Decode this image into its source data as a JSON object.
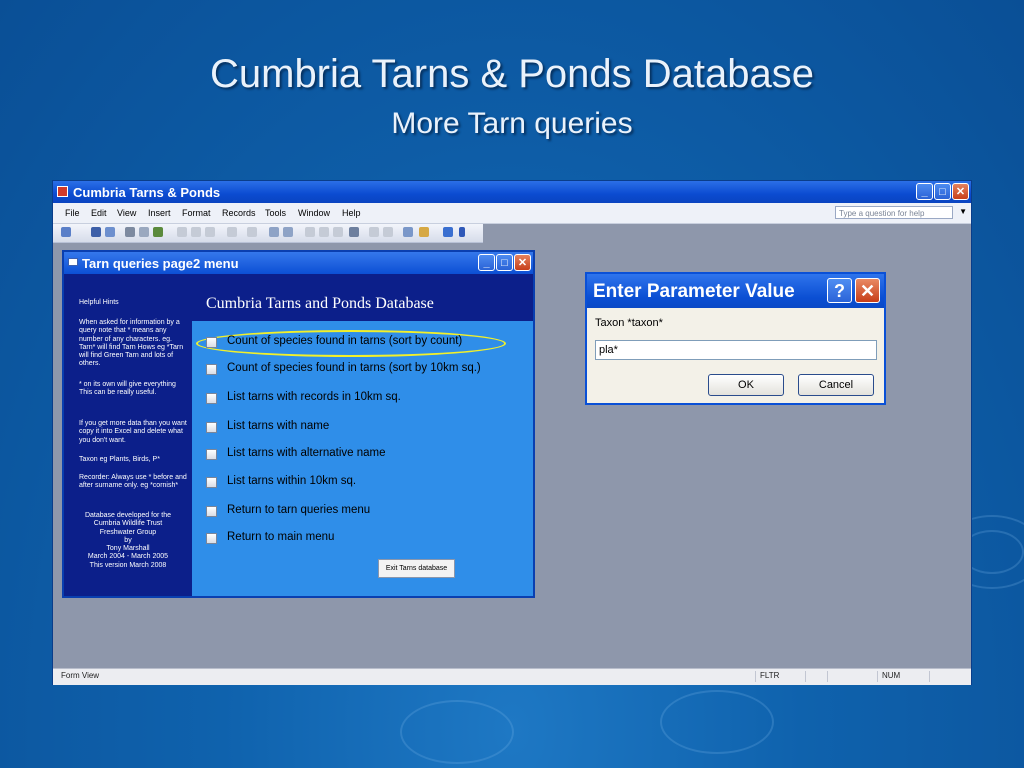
{
  "slide": {
    "title": "Cumbria Tarns & Ponds Database",
    "subtitle": "More Tarn queries"
  },
  "app_window": {
    "title": "Cumbria Tarns & Ponds",
    "menu": [
      "File",
      "Edit",
      "View",
      "Insert",
      "Format",
      "Records",
      "Tools",
      "Window",
      "Help"
    ],
    "help_placeholder": "Type a question for help"
  },
  "form": {
    "title": "Tarn queries page2 menu",
    "header": "Cumbria Tarns and Ponds Database",
    "hints_title": "Helpful Hints",
    "hints": [
      "When asked for information by a query note that * means any number of any characters. eg. Tarn* will find Tarn Hows eg *Tarn will find Green Tarn and lots of others.",
      "* on its own will give everything This can be really useful.",
      "If you get more data than you want copy it into Excel and delete what you don't want.",
      "Taxon eg Plants, Birds, P*",
      "Recorder: Always use * before and after surname only. eg *cornish*"
    ],
    "credits": [
      "Database developed for the",
      "Cumbria Wildlife Trust",
      "Freshwater Group",
      "by",
      "Tony Marshall",
      "March 2004 - March 2005",
      "This version March 2008"
    ],
    "options": [
      "Count of species found in tarns (sort by count)",
      "Count of species found in tarns (sort by 10km sq.)",
      "List tarns with records in 10km sq.",
      "List tarns with name",
      "List tarns with alternative name",
      "List tarns within 10km sq.",
      "Return to tarn queries menu",
      "Return to main menu"
    ],
    "exit_button": "Exit Tarns database"
  },
  "dialog": {
    "title": "Enter Parameter Value",
    "help_glyph": "?",
    "close_glyph": "✕",
    "prompt": "Taxon *taxon*",
    "value": "pla*",
    "ok": "OK",
    "cancel": "Cancel"
  },
  "statusbar": {
    "view": "Form View",
    "fltr": "FLTR",
    "num": "NUM"
  },
  "window_glyphs": {
    "minimize": "_",
    "maximize": "□",
    "close": "✕"
  }
}
